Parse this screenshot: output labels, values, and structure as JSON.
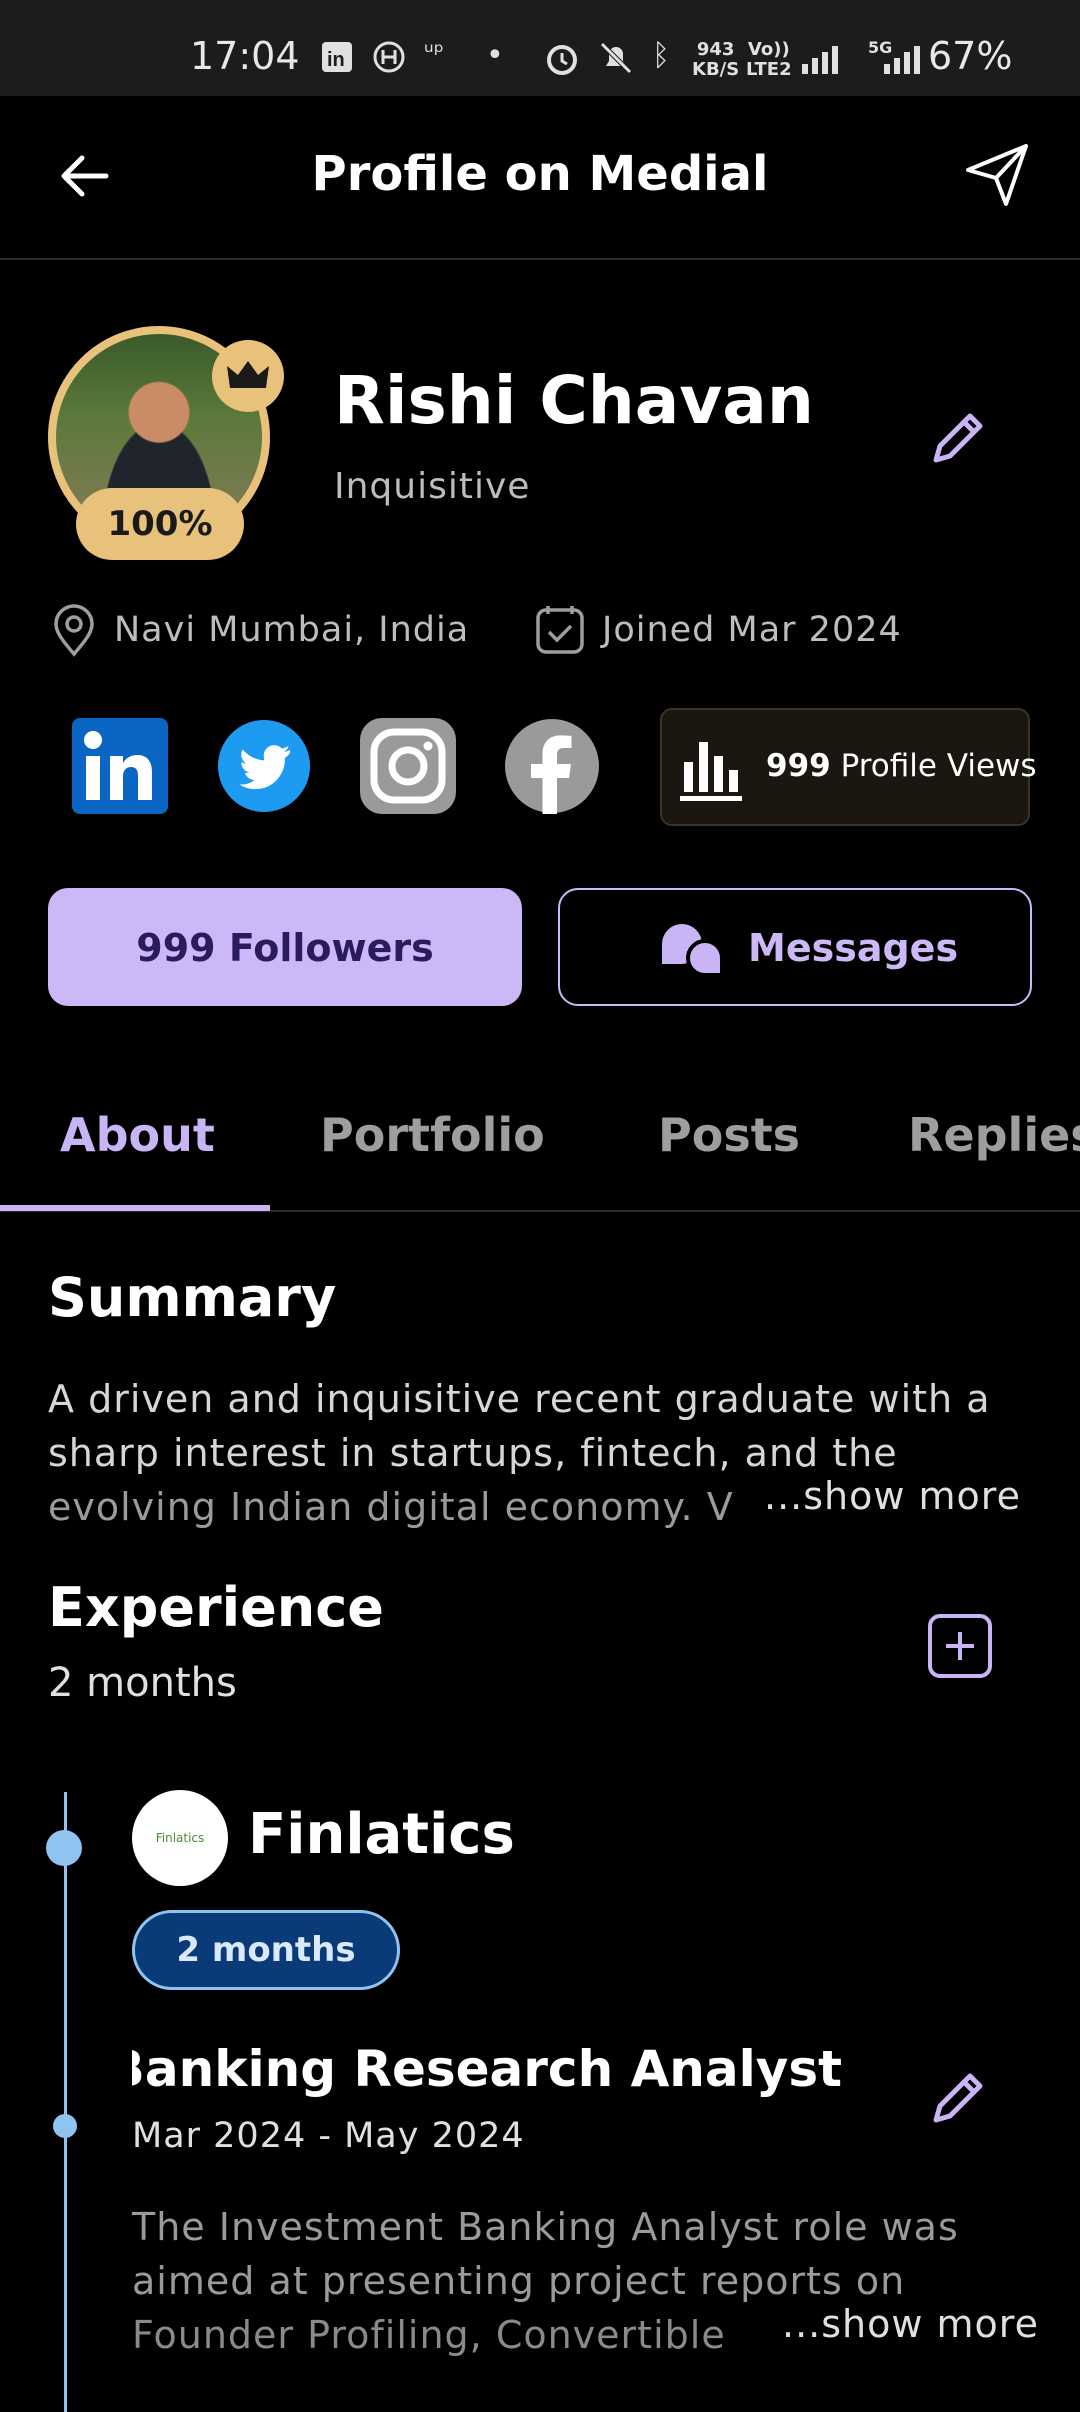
{
  "status_bar": {
    "time": "17:04",
    "net_speed_top": "943",
    "net_speed_bottom": "KB/S",
    "volte_top": "Vo))",
    "volte_bottom": "LTE2",
    "network": "5G",
    "battery": "67%"
  },
  "app_bar": {
    "title": "Profile on Medial",
    "back_icon": "arrow-left-icon",
    "share_icon": "send-icon"
  },
  "profile": {
    "name": "Rishi Chavan",
    "tagline": "Inquisitive",
    "completion": "100%",
    "location": "Navi Mumbai, India",
    "joined": "Joined Mar 2024",
    "profile_views_count": "999",
    "profile_views_label": "Profile Views"
  },
  "social": [
    "linkedin",
    "twitter",
    "instagram",
    "facebook"
  ],
  "actions": {
    "followers": "999 Followers",
    "messages": "Messages"
  },
  "tabs": [
    "About",
    "Portfolio",
    "Posts",
    "Replies"
  ],
  "active_tab": "About",
  "summary": {
    "heading": "Summary",
    "lines": [
      "A driven and inquisitive recent graduate with a",
      "sharp interest in startups, fintech, and the",
      "evolving Indian digital economy. V"
    ],
    "show_more": "...show more"
  },
  "experience": {
    "heading": "Experience",
    "total": "2 months",
    "items": [
      {
        "company": "Finlatics",
        "logo_text": "Finlatics",
        "duration": "2 months",
        "role": "Investment Banking Research Analyst",
        "dates": "Mar 2024 - May 2024",
        "description": [
          "The Investment Banking Analyst role was",
          "aimed at presenting project reports on",
          "Founder Profiling, Convertible"
        ],
        "show_more": "...show more"
      }
    ]
  },
  "colors": {
    "accent": "#cdb8f7",
    "gold": "#e8c27a",
    "timeline": "#8fc4f0"
  }
}
